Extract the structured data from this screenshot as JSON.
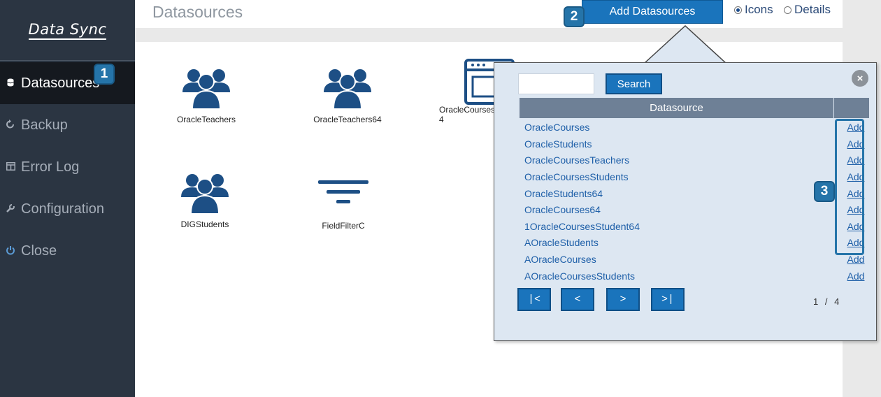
{
  "app": {
    "logo_text": "Data Sync"
  },
  "sidebar": {
    "items": [
      {
        "label": "Datasources",
        "icon": "database-icon",
        "active": true
      },
      {
        "label": "Backup",
        "icon": "refresh-icon"
      },
      {
        "label": "Error Log",
        "icon": "table-icon"
      },
      {
        "label": "Configuration",
        "icon": "wrench-icon"
      },
      {
        "label": "Close",
        "icon": "power-icon"
      }
    ]
  },
  "header": {
    "title": "Datasources",
    "add_button": "Add Datasources",
    "view_options": [
      {
        "label": "Icons",
        "selected": true
      },
      {
        "label": "Details",
        "selected": false
      }
    ]
  },
  "tiles": [
    {
      "label": "OracleTeachers",
      "icon": "users-icon"
    },
    {
      "label": "OracleTeachers64",
      "icon": "users-icon"
    },
    {
      "label": "OracleCourses\n4",
      "icon": "window-icon"
    },
    {
      "label": "DIGStudents",
      "icon": "users-icon"
    },
    {
      "label": "FieldFilterC",
      "icon": "filter-icon"
    }
  ],
  "popup": {
    "search_button": "Search",
    "search_value": "",
    "column_header": "Datasource",
    "close_glyph": "×",
    "rows": [
      {
        "name": "OracleCourses",
        "action": "Add"
      },
      {
        "name": "OracleStudents",
        "action": "Add"
      },
      {
        "name": "OracleCoursesTeachers",
        "action": "Add"
      },
      {
        "name": "OracleCoursesStudents",
        "action": "Add"
      },
      {
        "name": "OracleStudents64",
        "action": "Add"
      },
      {
        "name": "OracleCourses64",
        "action": "Add"
      },
      {
        "name": "1OracleCoursesStudent64",
        "action": "Add"
      },
      {
        "name": "AOracleStudents",
        "action": "Add"
      },
      {
        "name": "AOracleCourses",
        "action": "Add"
      },
      {
        "name": "AOracleCoursesStudents",
        "action": "Add"
      }
    ],
    "pager": {
      "first": "|<",
      "prev": "<",
      "next": ">",
      "last": ">|",
      "current_page": "1",
      "separator": "/",
      "total_pages": "4"
    }
  },
  "callouts": [
    "1",
    "2",
    "3"
  ],
  "colors": {
    "sidebar": "#2b3542",
    "accent": "#1a74bc",
    "link": "#1e5fa8",
    "icon": "#1d4f85"
  }
}
